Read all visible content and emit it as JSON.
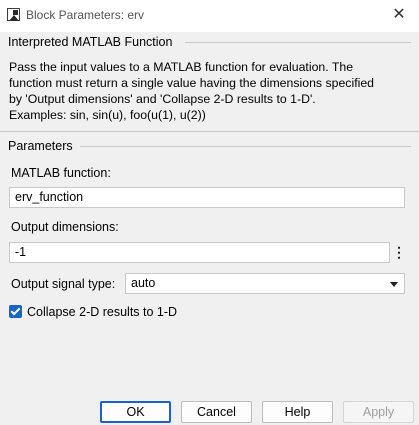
{
  "window": {
    "title": "Block Parameters: erv",
    "icon": "simulink-block-icon",
    "close_glyph": "✕"
  },
  "block": {
    "heading": "Interpreted MATLAB Function",
    "description": [
      "Pass the input values to a MATLAB function for evaluation.  The",
      "function must return a single value having the dimensions specified",
      "by 'Output dimensions' and 'Collapse 2-D results to 1-D'.",
      "Examples: sin, sin(u), foo(u(1), u(2))"
    ]
  },
  "parameters": {
    "heading": "Parameters",
    "matlab_function": {
      "label": "MATLAB function:",
      "value": "erv_function"
    },
    "output_dimensions": {
      "label": "Output dimensions:",
      "value": "-1",
      "more_glyph": "⋮"
    },
    "output_signal_type": {
      "label": "Output signal type:",
      "value": "auto"
    },
    "collapse": {
      "label": "Collapse 2-D results to 1-D",
      "checked": true
    }
  },
  "buttons": {
    "ok": "OK",
    "cancel": "Cancel",
    "help": "Help",
    "apply": "Apply"
  },
  "colors": {
    "accent": "#1a63c9",
    "background": "#f0f0f0"
  }
}
